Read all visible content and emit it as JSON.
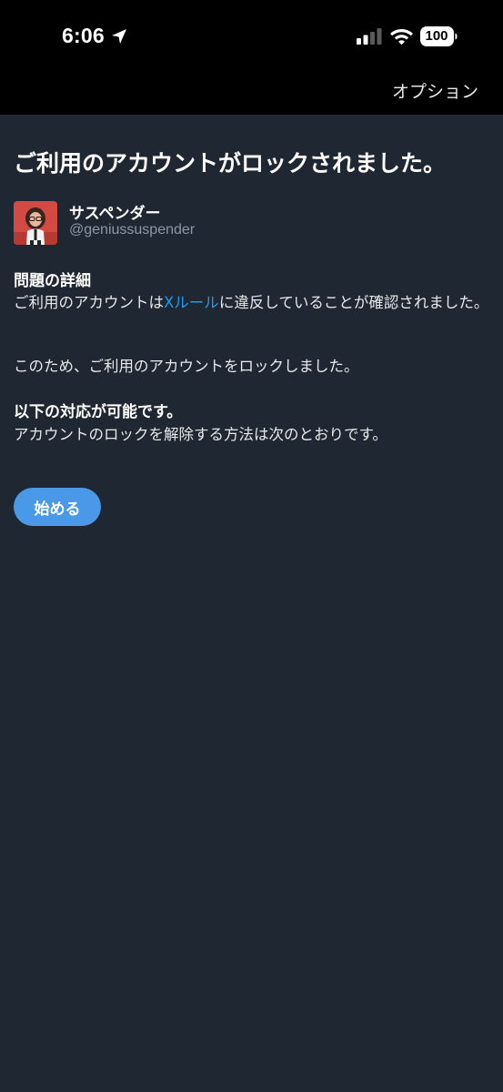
{
  "status_bar": {
    "time": "6:06",
    "battery": "100",
    "icons": [
      "location-arrow-icon",
      "cellular-signal-icon",
      "wifi-icon",
      "battery-icon"
    ]
  },
  "nav": {
    "options_label": "オプション"
  },
  "page": {
    "title": "ご利用のアカウントがロックされました。"
  },
  "account": {
    "display_name": "サスペンダー",
    "username": "@geniussuspender"
  },
  "details": {
    "heading": "問題の詳細",
    "text_before_link": "ご利用のアカウントは",
    "link_text": "Xルール",
    "text_after_link": "に違反していることが確認されました。",
    "lock_text": "このため、ご利用のアカウントをロックしました。"
  },
  "actions": {
    "heading": "以下の対応が可能です。",
    "text": "アカウントのロックを解除する方法は次のとおりです。",
    "start_label": "始める"
  },
  "colors": {
    "background": "#1f2732",
    "status_bar": "#000000",
    "accent": "#4a99e9",
    "link": "#1d9bf0",
    "secondary_text": "#8b98a5"
  }
}
